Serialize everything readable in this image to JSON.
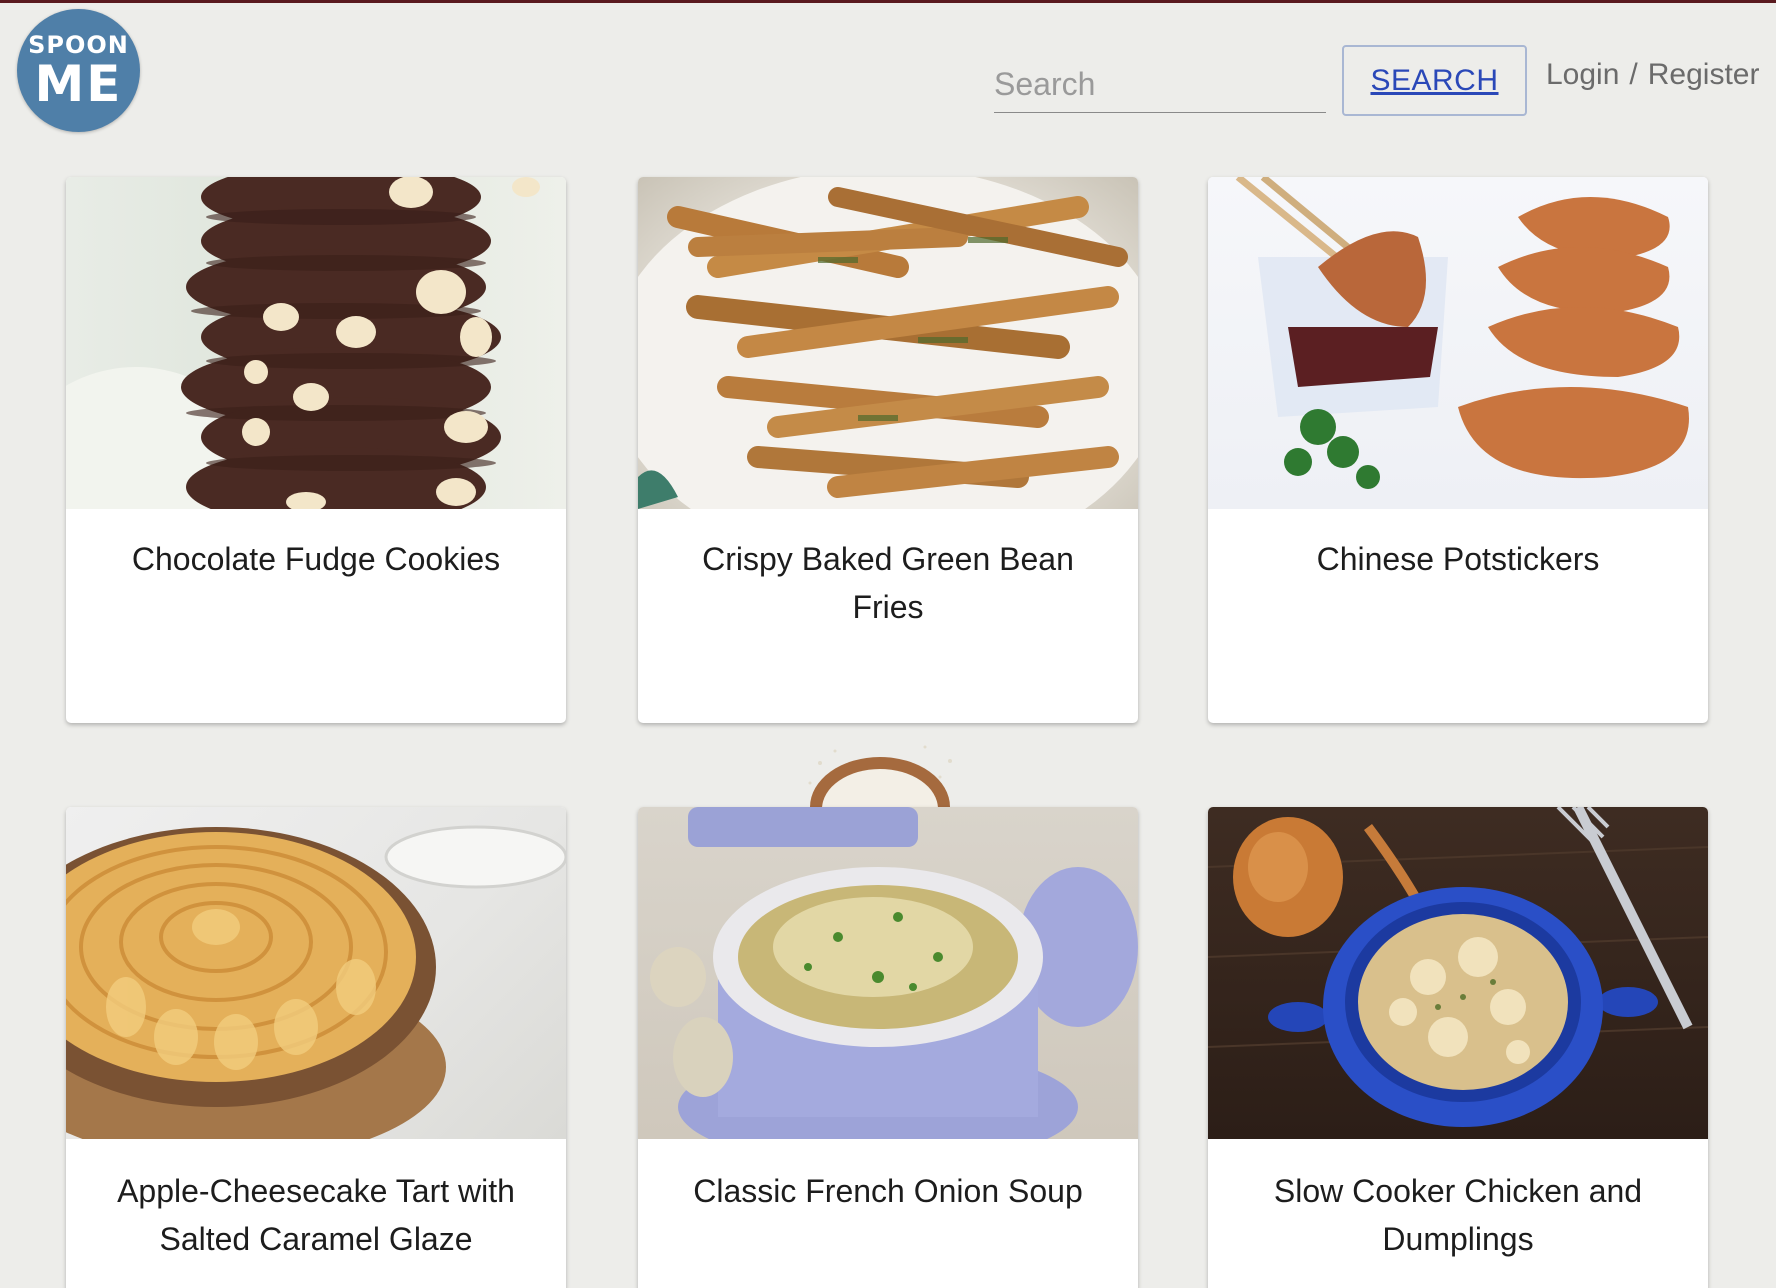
{
  "header": {
    "logo": {
      "line1": "SPOON",
      "line2": "ME"
    },
    "search": {
      "placeholder": "Search",
      "value": "",
      "button_label": "SEARCH"
    },
    "auth": {
      "login_label": "Login",
      "separator": "/",
      "register_label": "Register"
    }
  },
  "recipes": [
    {
      "title": "Chocolate Fudge Cookies",
      "image_icon": "cookie-stack-photo"
    },
    {
      "title": "Crispy Baked Green Bean Fries",
      "image_icon": "green-bean-fries-photo"
    },
    {
      "title": "Chinese Potstickers",
      "image_icon": "potstickers-photo"
    },
    {
      "title": "Apple-Cheesecake Tart with Salted Caramel Glaze",
      "image_icon": "apple-tart-photo"
    },
    {
      "title": "Classic French Onion Soup",
      "image_icon": "onion-soup-photo"
    },
    {
      "title": "Slow Cooker Chicken and Dumplings",
      "image_icon": "chicken-dumplings-photo"
    }
  ],
  "colors": {
    "background": "#ededea",
    "logo": "#4f7fa8",
    "top_border": "#5a1a1f",
    "search_button_text": "#2a48b8",
    "search_button_border": "#a9b7d3"
  }
}
